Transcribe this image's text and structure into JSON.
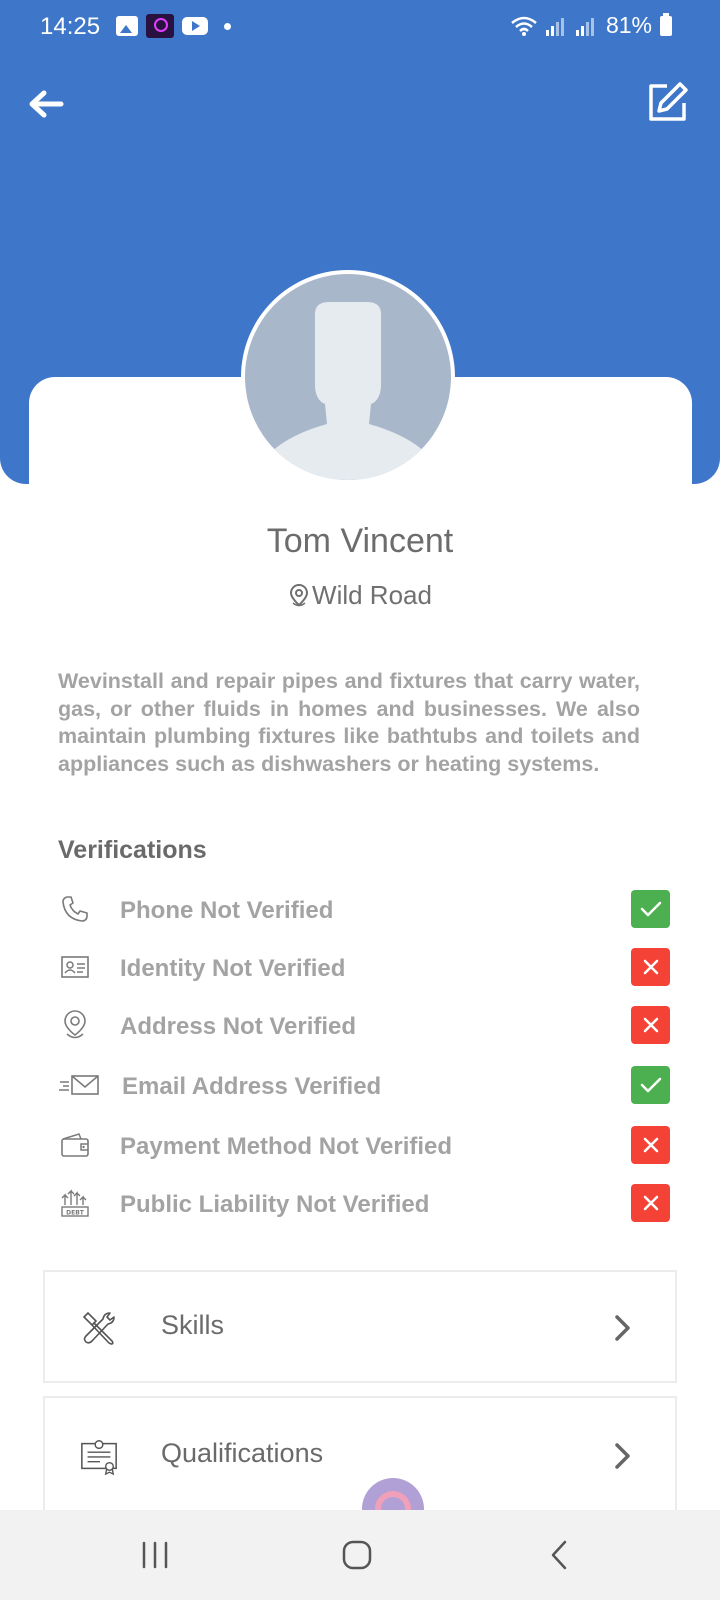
{
  "status_bar": {
    "time": "14:25",
    "battery": "81%",
    "icons": [
      "gallery-icon",
      "app-icon",
      "youtube-icon",
      "notification-dot",
      "wifi-icon",
      "signal-icon",
      "battery-icon"
    ]
  },
  "header": {
    "back_icon": "arrow-left-icon",
    "edit_icon": "edit-icon",
    "background_color": "#3e77c9"
  },
  "profile": {
    "name": "Tom Vincent",
    "location": "Wild Road",
    "bio": "Wevinstall and repair pipes and fixtures that carry water, gas, or other fluids in homes and businesses. We also maintain plumbing fixtures like bathtubs and toilets and appliances such as dishwashers or heating systems."
  },
  "verifications": {
    "title": "Verifications",
    "items": [
      {
        "label": "Phone Not Verified",
        "icon": "phone-icon",
        "status": "check"
      },
      {
        "label": "Identity Not Verified",
        "icon": "id-card-icon",
        "status": "cross"
      },
      {
        "label": "Address Not Verified",
        "icon": "location-pin-icon",
        "status": "cross"
      },
      {
        "label": "Email Address Verified",
        "icon": "email-icon",
        "status": "check"
      },
      {
        "label": "Payment Method Not Verified",
        "icon": "wallet-icon",
        "status": "cross"
      },
      {
        "label": "Public Liability Not Verified",
        "icon": "debt-icon",
        "status": "cross"
      }
    ],
    "colors": {
      "check": "#4caf50",
      "cross": "#f44336"
    }
  },
  "menu": [
    {
      "label": "Skills",
      "icon": "tools-icon"
    },
    {
      "label": "Qualifications",
      "icon": "certificate-icon"
    }
  ],
  "nav_bar": {
    "buttons": [
      "recent-apps-icon",
      "home-icon",
      "back-icon"
    ]
  }
}
